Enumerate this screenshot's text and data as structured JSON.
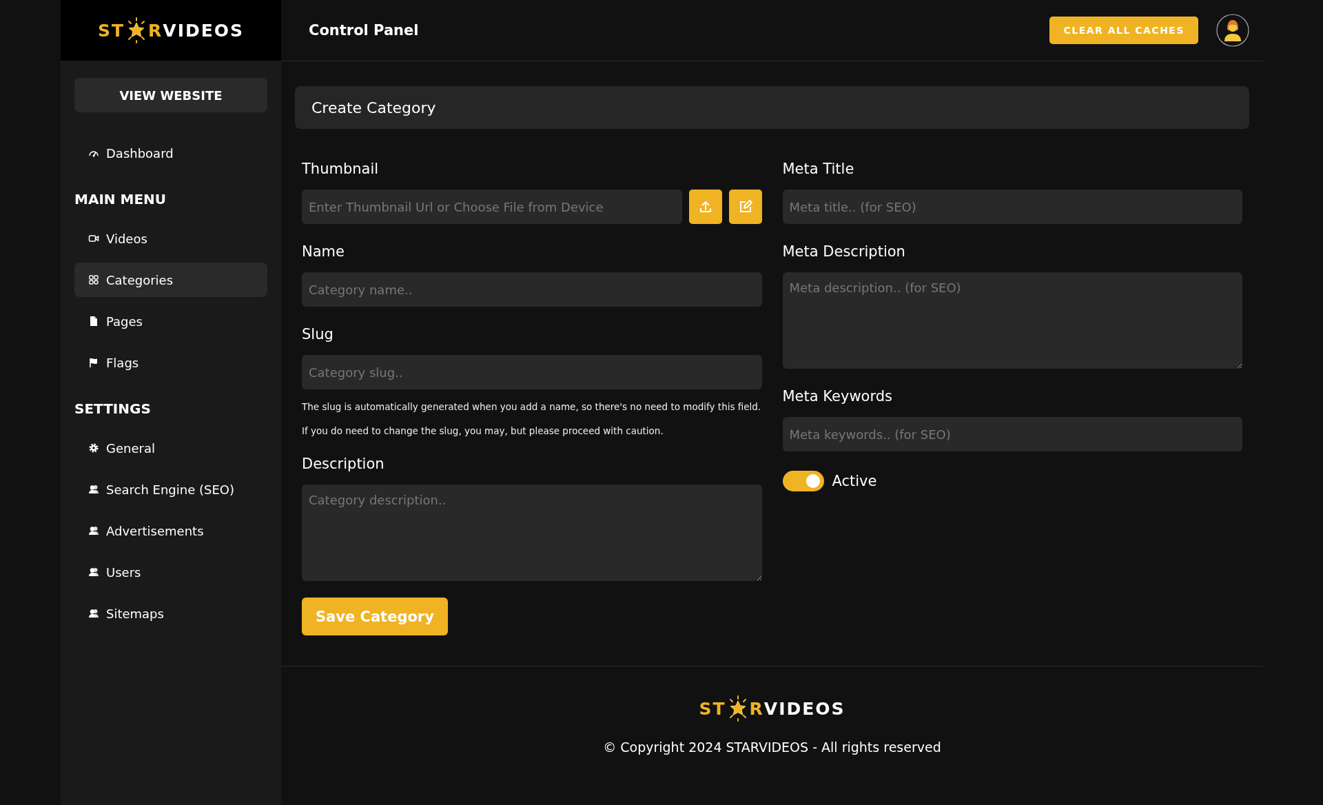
{
  "logo": {
    "accent_start": "ST",
    "accent_end": "R",
    "rest": "VIDEOS"
  },
  "header": {
    "title": "Control Panel",
    "clear_button": "CLEAR ALL CACHES"
  },
  "sidebar": {
    "view_button": "VIEW WEBSITE",
    "sections": [
      {
        "items": [
          {
            "label": "Dashboard",
            "kind": "gauge",
            "selected": false
          }
        ]
      },
      {
        "heading": "MAIN MENU",
        "items": [
          {
            "label": "Videos",
            "kind": "video",
            "selected": false
          },
          {
            "label": "Categories",
            "kind": "grid",
            "selected": true
          },
          {
            "label": "Pages",
            "kind": "page",
            "selected": false
          },
          {
            "label": "Flags",
            "kind": "flag",
            "selected": false
          }
        ]
      },
      {
        "heading": "SETTINGS",
        "items": [
          {
            "label": "General",
            "kind": "gear",
            "selected": false
          },
          {
            "label": "Search Engine (SEO)",
            "kind": "users",
            "selected": false
          },
          {
            "label": "Advertisements",
            "kind": "users",
            "selected": false
          },
          {
            "label": "Users",
            "kind": "users",
            "selected": false
          },
          {
            "label": "Sitemaps",
            "kind": "users",
            "selected": false
          }
        ]
      }
    ]
  },
  "form": {
    "title": "Create Category",
    "left": [
      {
        "kind": "thumbnail",
        "label": "Thumbnail",
        "placeholder": "Enter Thumbnail Url or Choose File from Device"
      },
      {
        "kind": "input",
        "label": "Name",
        "placeholder": "Category name.."
      },
      {
        "kind": "input",
        "label": "Slug",
        "placeholder": "Category slug..",
        "help": "The slug is automatically generated when you add a name, so there's no need to modify this field. If you do need to change the slug, you may, but please proceed with caution."
      },
      {
        "kind": "textarea",
        "label": "Description",
        "placeholder": "Category description.."
      }
    ],
    "right": [
      {
        "kind": "input",
        "label": "Meta Title",
        "placeholder": "Meta title.. (for SEO)"
      },
      {
        "kind": "textarea",
        "label": "Meta Description",
        "placeholder": "Meta description.. (for SEO)"
      },
      {
        "kind": "input",
        "label": "Meta Keywords",
        "placeholder": "Meta keywords.. (for SEO)"
      },
      {
        "kind": "toggle",
        "label": "Active",
        "on": true
      }
    ],
    "save_button": "Save Category"
  },
  "footer": {
    "logo": {
      "accent_start": "ST",
      "accent_end": "R",
      "rest": "VIDEOS"
    },
    "copyright_symbol": "©",
    "copyright": "Copyright 2024 STARVIDEOS - All rights reserved"
  }
}
